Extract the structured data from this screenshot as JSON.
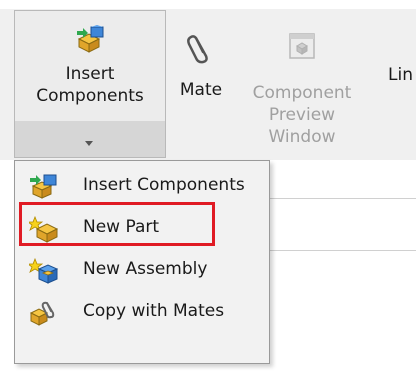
{
  "ribbon": {
    "insert_components": {
      "line1": "Insert",
      "line2": "Components"
    },
    "mate": {
      "label": "Mate"
    },
    "component_preview": {
      "line1": "Component",
      "line2": "Preview",
      "line3": "Window"
    },
    "partial_label": "Lin"
  },
  "menu": {
    "items": [
      {
        "label": "Insert Components",
        "icon": "insert-components-icon"
      },
      {
        "label": "New Part",
        "icon": "new-part-icon",
        "highlighted": true
      },
      {
        "label": "New Assembly",
        "icon": "new-assembly-icon"
      },
      {
        "label": "Copy with Mates",
        "icon": "copy-with-mates-icon"
      }
    ]
  },
  "colors": {
    "highlight": "#e01b24",
    "ribbon_bg": "#f0f0f0",
    "menu_bg": "#f2f2f2",
    "disabled_text": "#a0a0a0"
  }
}
